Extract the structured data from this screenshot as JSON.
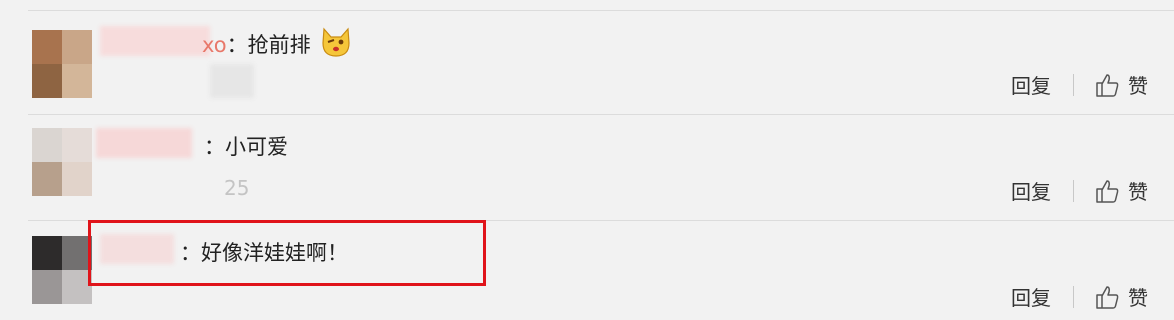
{
  "comments": [
    {
      "name_fragment": "xo",
      "text": "：抢前排",
      "emoji": "fox-face-icon",
      "reply_label": "回复",
      "like_label": "赞"
    },
    {
      "name_fragment": "",
      "text": "：小可爱",
      "faded_text": "25",
      "reply_label": "回复",
      "like_label": "赞"
    },
    {
      "name_fragment": "",
      "text": "：好像洋娃娃啊！",
      "reply_label": "回复",
      "like_label": "赞",
      "highlighted": true
    }
  ],
  "colors": {
    "highlight_border": "#e0141a",
    "name_fragment": "#e8786a",
    "background": "#f2f2f2"
  }
}
